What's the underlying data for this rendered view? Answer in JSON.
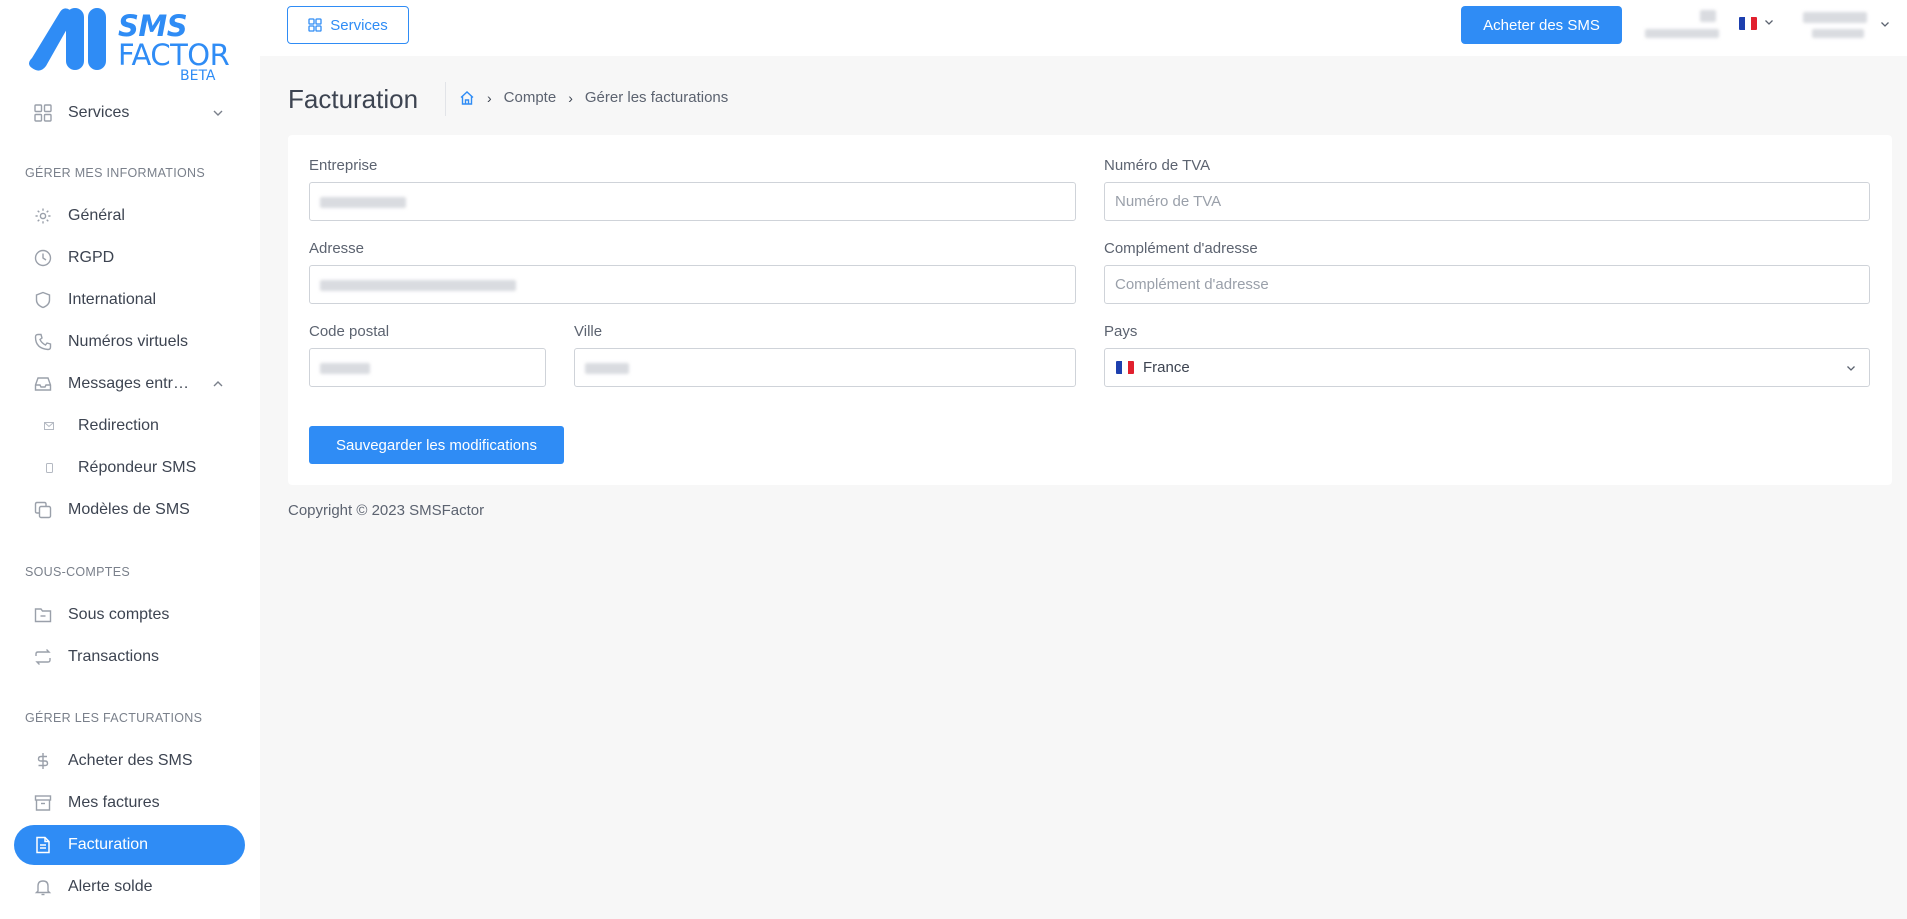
{
  "brand": {
    "line1": "SMS",
    "line2": "FACTOR",
    "badge": "BETA",
    "color": "#2f8cf5"
  },
  "topbar": {
    "services_label": "Services",
    "buy_label": "Acheter des SMS",
    "language_flag": "france-flag"
  },
  "sidebar": {
    "services": {
      "label": "Services"
    },
    "section_info": "GÉRER MES INFORMATIONS",
    "section_subaccounts": "SOUS-COMPTES",
    "section_billing": "GÉRER LES FACTURATIONS",
    "items": {
      "general": "Général",
      "rgpd": "RGPD",
      "international": "International",
      "numeros_virtuels": "Numéros virtuels",
      "messages_entrants": "Messages entr…",
      "redirection": "Redirection",
      "repondeur": "Répondeur SMS",
      "modeles": "Modèles de SMS",
      "sous_comptes": "Sous comptes",
      "transactions": "Transactions",
      "acheter": "Acheter des SMS",
      "mes_factures": "Mes factures",
      "facturation": "Facturation",
      "alerte_solde": "Alerte solde"
    },
    "active_item": "facturation"
  },
  "page": {
    "title": "Facturation",
    "breadcrumb": [
      "Compte",
      "Gérer les facturations"
    ]
  },
  "form": {
    "entreprise_label": "Entreprise",
    "tva_label": "Numéro de TVA",
    "tva_placeholder": "Numéro de TVA",
    "adresse_label": "Adresse",
    "complement_label": "Complément d'adresse",
    "complement_placeholder": "Complément d'adresse",
    "code_postal_label": "Code postal",
    "ville_label": "Ville",
    "pays_label": "Pays",
    "pays_value": "France",
    "save_label": "Sauvegarder les modifications"
  },
  "footer": {
    "copyright": "Copyright © 2023 SMSFactor"
  },
  "colors": {
    "accent": "#2f8cf5",
    "page_bg": "#f7f7f7"
  }
}
